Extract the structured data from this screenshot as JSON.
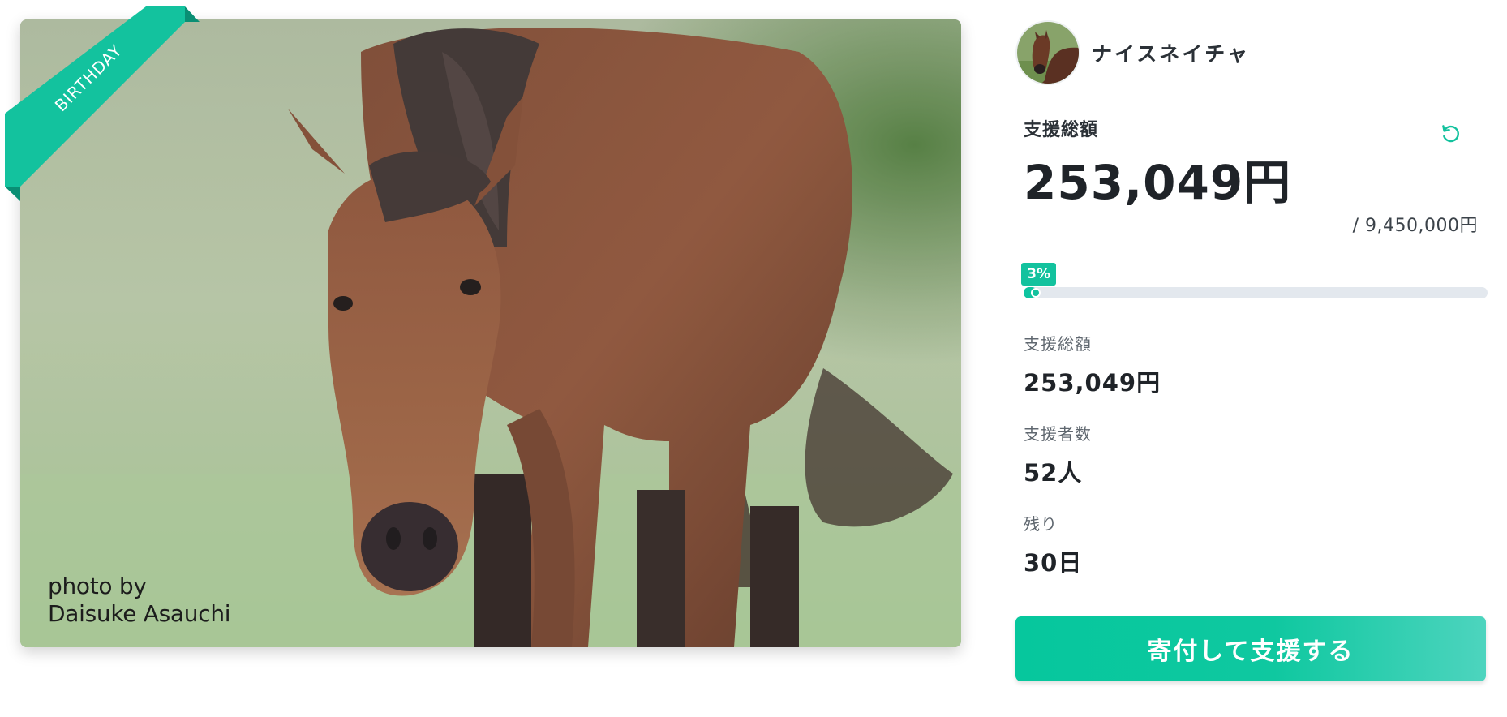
{
  "hero": {
    "ribbon_label": "BIRTHDAY",
    "credit_line1": "photo by",
    "credit_line2": "Daisuke Asauchi",
    "image_subject": "horse-photo"
  },
  "org": {
    "name": "ナイスネイチャ",
    "avatar_icon": "horse-avatar"
  },
  "funding": {
    "total_label": "支援総額",
    "total_amount": "253,049円",
    "goal": "/ 9,450,000円",
    "progress_percent": 3,
    "progress_label": "3%",
    "refresh_icon": "refresh-icon"
  },
  "stats": [
    {
      "label": "支援総額",
      "value": "253,049円"
    },
    {
      "label": "支援者数",
      "value": "52人"
    },
    {
      "label": "残り",
      "value": "30日"
    }
  ],
  "cta": {
    "donate_label": "寄付して支援する"
  },
  "colors": {
    "accent": "#13c29e",
    "progress_track": "#e3e8ee",
    "text_dark": "#1f2328",
    "text_muted": "#5f676f"
  }
}
